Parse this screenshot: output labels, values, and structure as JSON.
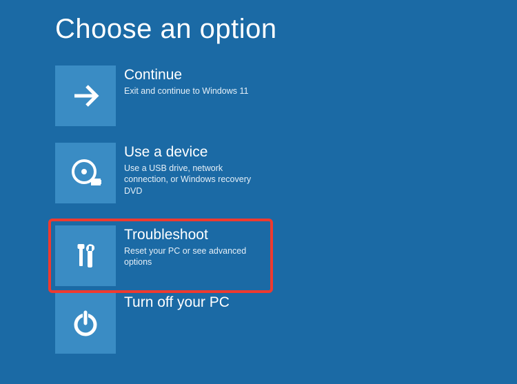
{
  "title": "Choose an option",
  "tiles": {
    "continue": {
      "title": "Continue",
      "desc": "Exit and continue to Windows 11"
    },
    "use_device": {
      "title": "Use a device",
      "desc": "Use a USB drive, network connection, or Windows recovery DVD"
    },
    "troubleshoot": {
      "title": "Troubleshoot",
      "desc": "Reset your PC or see advanced options"
    },
    "turn_off": {
      "title": "Turn off your PC",
      "desc": ""
    }
  }
}
